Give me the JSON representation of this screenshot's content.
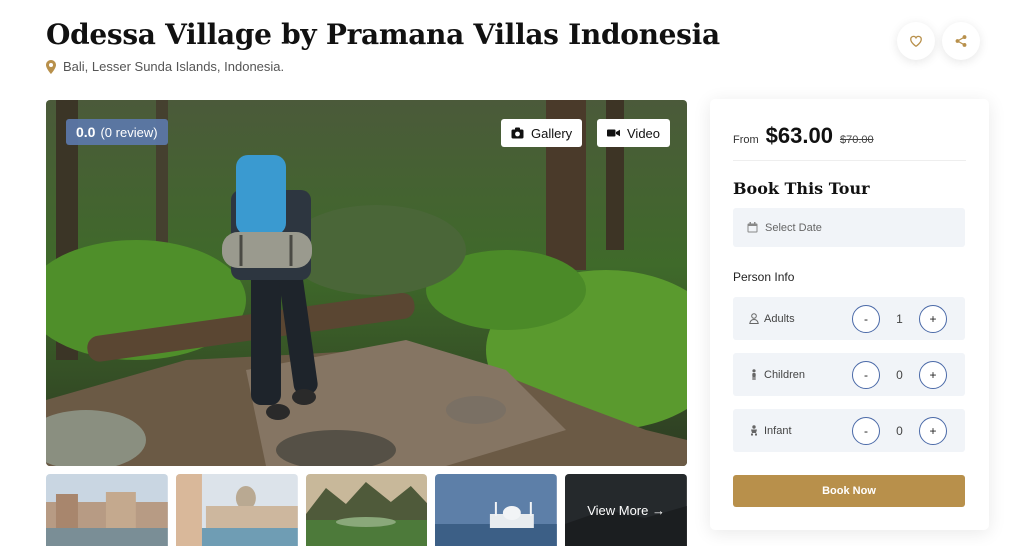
{
  "header": {
    "title": "Odessa Village by Pramana Villas Indonesia",
    "location": "Bali, Lesser Sunda Islands, Indonesia.",
    "wishlist_icon": "heart-icon",
    "share_icon": "share-icon"
  },
  "hero": {
    "rating_score": "0.0",
    "rating_count": "(0 review)",
    "gallery_label": "Gallery",
    "video_label": "Video"
  },
  "thumbnails": {
    "view_more_label": "View More →"
  },
  "booking": {
    "price_from": "From",
    "price_current": "$63.00",
    "price_original": "$70.00",
    "title": "Book This Tour",
    "date_placeholder": "Select Date",
    "person_info_label": "Person Info",
    "counters": [
      {
        "label": "Adults",
        "value": "1",
        "minus": "-",
        "plus": "+"
      },
      {
        "label": "Children",
        "value": "0",
        "minus": "-",
        "plus": "+"
      },
      {
        "label": "Infant",
        "value": "0",
        "minus": "-",
        "plus": "+"
      }
    ],
    "book_now_label": "Book Now"
  },
  "colors": {
    "accent": "#b8904b",
    "rating_badge": "#5c78aa",
    "field_bg": "#f1f4f8",
    "stepper_border": "#4b6aa8"
  }
}
